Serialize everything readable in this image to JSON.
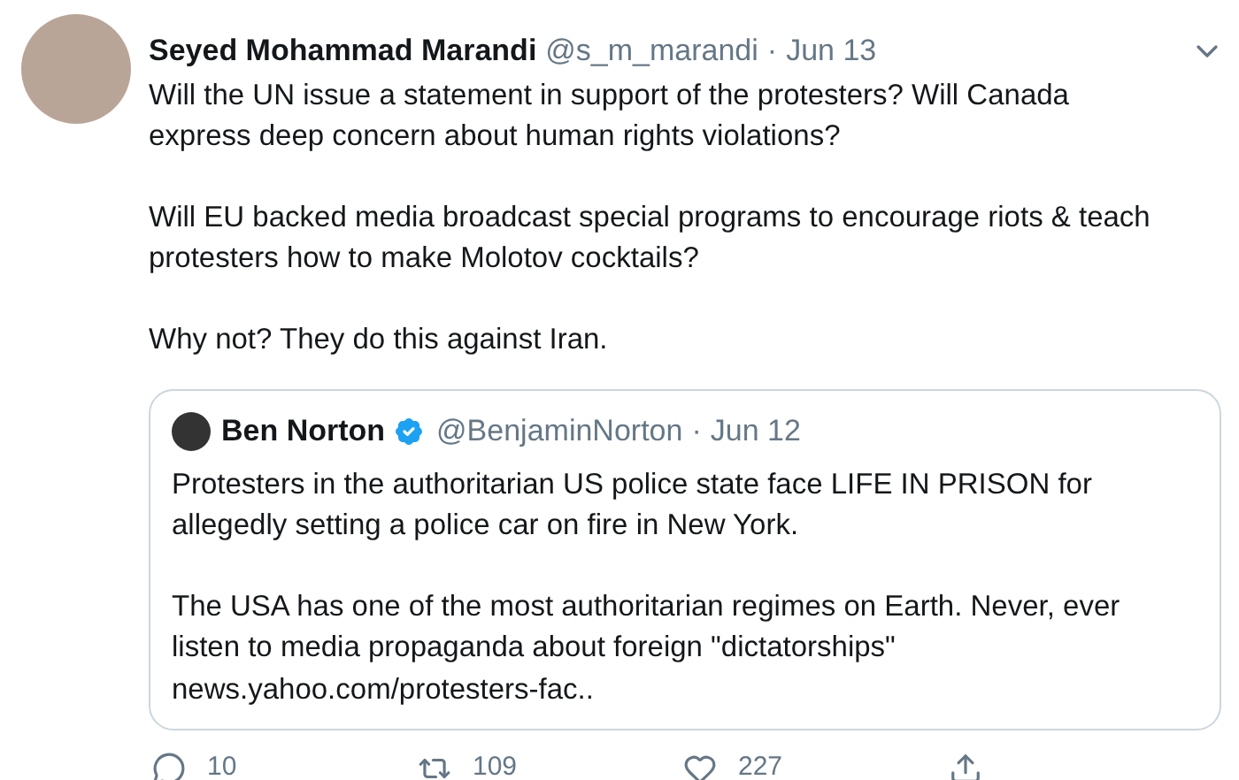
{
  "tweet": {
    "author": "Seyed Mohammad Marandi",
    "handle": "@s_m_marandi",
    "separator": "·",
    "date": "Jun 13",
    "paragraphs": [
      "Will the UN issue a statement in support of the protesters? Will Canada express deep concern about human rights violations?",
      "Will EU backed media broadcast special programs to encourage riots & teach protesters how to make Molotov cocktails?",
      "Why not? They do this against Iran."
    ]
  },
  "quote": {
    "author": "Ben Norton",
    "verified": true,
    "handle": "@BenjaminNorton",
    "separator": "·",
    "date": "Jun 12",
    "paragraphs": [
      "Protesters in the authoritarian US police state face LIFE IN PRISON for allegedly setting a police car on fire in New York.",
      "The USA has one of the most authoritarian regimes on Earth. Never, ever listen to media propaganda about foreign \"dictatorships\" news.yahoo.com/protesters-fac.."
    ]
  },
  "actions": [
    {
      "kind": "reply",
      "count": "10"
    },
    {
      "kind": "retweet",
      "count": "109"
    },
    {
      "kind": "like",
      "count": "227"
    },
    {
      "kind": "share"
    }
  ]
}
